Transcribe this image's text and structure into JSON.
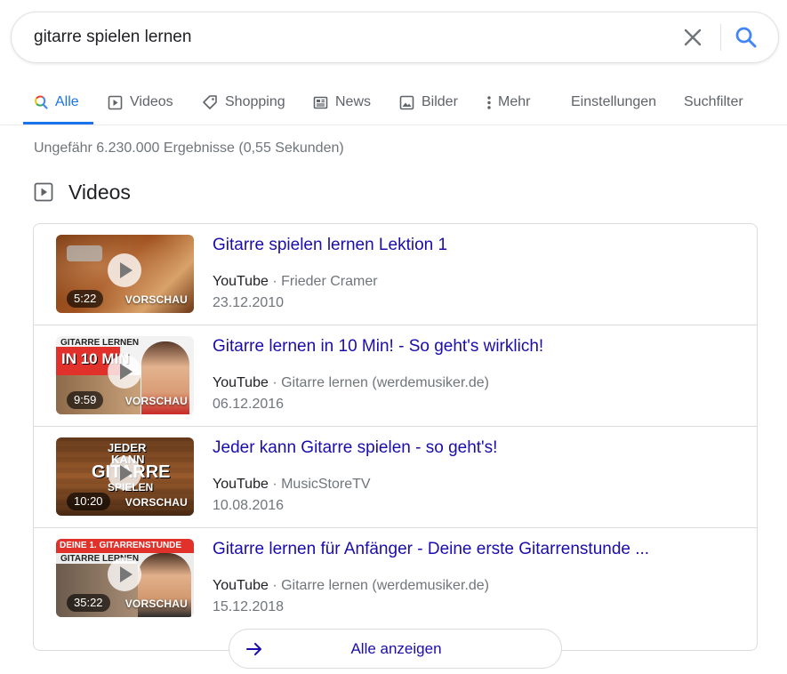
{
  "search": {
    "query": "gitarre spielen lernen"
  },
  "tabs": [
    {
      "label": "Alle",
      "icon": "search-multicolor-icon",
      "active": true
    },
    {
      "label": "Videos",
      "icon": "play-box-icon"
    },
    {
      "label": "Shopping",
      "icon": "tag-icon"
    },
    {
      "label": "News",
      "icon": "newspaper-icon"
    },
    {
      "label": "Bilder",
      "icon": "image-icon"
    },
    {
      "label": "Mehr",
      "icon": "more-vert-icon"
    },
    {
      "label": "Einstellungen"
    },
    {
      "label": "Suchfilter"
    }
  ],
  "result_stats": "Ungefähr 6.230.000 Ergebnisse (0,55 Sekunden)",
  "videos_section": {
    "title": "Videos",
    "preview_label": "VORSCHAU",
    "items": [
      {
        "title": "Gitarre spielen lernen Lektion 1",
        "platform": "YouTube",
        "channel": "Frieder Cramer",
        "date": "23.12.2010",
        "duration": "5:22"
      },
      {
        "title": "Gitarre lernen in 10 Min! - So geht's wirklich!",
        "platform": "YouTube",
        "channel": "Gitarre lernen (werdemusiker.de)",
        "date": "06.12.2016",
        "duration": "9:59",
        "thumb_text": [
          "GITARRE LERNEN",
          "IN 10 MIN"
        ]
      },
      {
        "title": "Jeder kann Gitarre spielen - so geht's!",
        "platform": "YouTube",
        "channel": "MusicStoreTV",
        "date": "10.08.2016",
        "duration": "10:20",
        "thumb_text": [
          "JEDER",
          "KANN",
          "GITARRE",
          "SPIELEN"
        ]
      },
      {
        "title": "Gitarre lernen für Anfänger - Deine erste Gitarrenstunde ...",
        "platform": "YouTube",
        "channel": "Gitarre lernen (werdemusiker.de)",
        "date": "15.12.2018",
        "duration": "35:22",
        "thumb_text": [
          "DEINE 1. GITARRENSTUNDE",
          "GITARRE LERNEN"
        ]
      }
    ],
    "show_all_label": "Alle anzeigen"
  },
  "colors": {
    "accent": "#1a73e8",
    "link": "#1a0dab",
    "secondary_text": "#70757a",
    "border": "#dadce0"
  }
}
